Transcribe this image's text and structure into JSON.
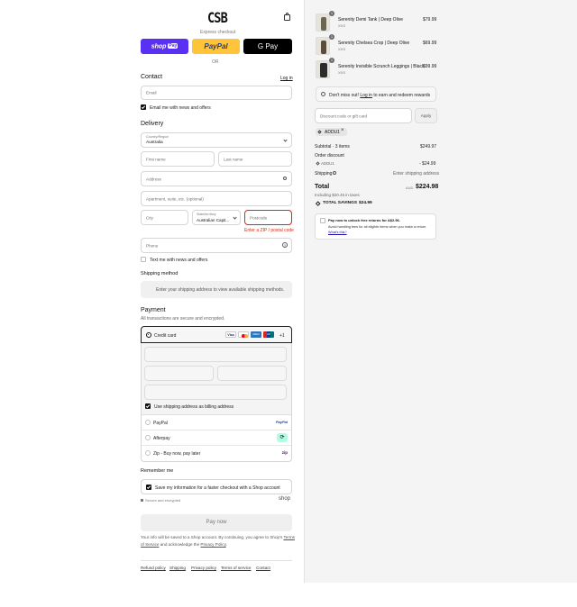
{
  "brand": {
    "logo": "CSB"
  },
  "express": {
    "label": "Express checkout",
    "shop_pay": "shop",
    "shop_pay_suffix": "Pay",
    "paypal": "PayPal",
    "gpay": "G Pay",
    "or": "OR"
  },
  "contact": {
    "heading": "Contact",
    "login_link": "Log in",
    "email_placeholder": "Email",
    "news_label": "Email me with news and offers"
  },
  "delivery": {
    "heading": "Delivery",
    "country_label": "Country/Region",
    "country_value": "Australia",
    "first_name": "First name",
    "last_name": "Last name",
    "address": "Address",
    "apartment": "Apartment, suite, etc. (optional)",
    "city": "City",
    "state_label": "State/territory",
    "state_value": "Australian Capit...",
    "postcode": "Postcode",
    "postcode_error": "Enter a ZIP / postal code",
    "phone": "Phone",
    "text_news": "Text me with news and offers"
  },
  "shipping_method": {
    "heading": "Shipping method",
    "placeholder": "Enter your shipping address to view available shipping methods."
  },
  "payment": {
    "heading": "Payment",
    "subtitle": "All transactions are secure and encrypted.",
    "credit_card": "Credit card",
    "card_brands": [
      "Visa",
      "MC",
      "AMEX",
      "UP"
    ],
    "more_cards": "+1",
    "billing_label": "Use shipping address as billing address",
    "options": [
      {
        "label": "PayPal",
        "logo": "PayPal"
      },
      {
        "label": "Afterpay",
        "logo": "⟳"
      },
      {
        "label": "Zip - Buy now, pay later",
        "logo": "zip"
      }
    ]
  },
  "remember": {
    "heading": "Remember me",
    "save_label": "Save my information for a faster checkout with a Shop account",
    "secure": "Secure and encrypted",
    "shop_logo": "shop"
  },
  "pay_button": "Pay now",
  "legal": {
    "pre": "Your info will be saved to a Shop account. By continuing, you agree to Shop's",
    "terms": "Terms of Service",
    "mid": "and acknowledge the",
    "privacy": "Privacy Policy",
    "end": "."
  },
  "footer_links": [
    "Refund policy",
    "Shipping",
    "Privacy policy",
    "Terms of service",
    "Contact"
  ],
  "cart": {
    "items": [
      {
        "qty": "1",
        "name": "Serenity Demi Tank | Deep Olive",
        "variant": "XXS",
        "price": "$79.99"
      },
      {
        "qty": "1",
        "name": "Serenity Chelsea Crop | Deep Olive",
        "variant": "XXS",
        "price": "$69.99"
      },
      {
        "qty": "1",
        "name": "Serenity Invisible Scrunch Leggings | Black",
        "variant": "XXS",
        "price": "$99.99"
      }
    ],
    "rewards_pre": "Don't miss out!",
    "rewards_link": "Log in",
    "rewards_post": "to earn and redeem rewards",
    "discount_placeholder": "Discount code or gift card",
    "apply": "Apply",
    "code_tag": "ADDU1",
    "subtotal_label": "Subtotal · 3 items",
    "subtotal_value": "$249.97",
    "order_discount": "Order discount",
    "discount_code": "ADDU1",
    "discount_value": "- $24.99",
    "shipping_label": "Shipping",
    "shipping_value": "Enter shipping address",
    "total_label": "Total",
    "currency": "AUD",
    "total_value": "$224.98",
    "taxes": "Including $20.45 in taxes",
    "savings_label": "TOTAL SAVINGS",
    "savings_value": "$24.99",
    "returns_title": "Pay now to unlock free returns for A$2.96.",
    "returns_body": "Avoid handling fees for all eligible items when you make a return.",
    "returns_link": "What's this?"
  },
  "colors": {
    "shop_pay": "#5a31f4",
    "paypal": "#ffc439",
    "error": "#d82c0d",
    "tag": "#e5e5e5"
  }
}
